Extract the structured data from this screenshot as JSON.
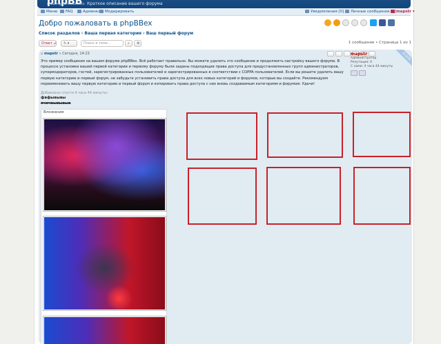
{
  "header": {
    "logo": "phpBB",
    "logo_sub": "creating communities",
    "site_desc": "Краткое описание вашего форума"
  },
  "nav": {
    "menu": "Меню",
    "faq": "FAQ",
    "admin": "Админка",
    "moderate": "Модерировать",
    "notifications": "Уведомления [0]",
    "messages": "Личные сообщения [0]",
    "user": "mapstr"
  },
  "topic": {
    "title": "Добро пожаловать в phpBBex"
  },
  "breadcrumbs": {
    "b1": "Список разделов",
    "b2": "Ваша первая категория",
    "b3": "Ваш первый форум",
    "sep": "›"
  },
  "toolbar": {
    "reply": "Ответ",
    "search_placeholder": "Поиск в теме...",
    "pagination": "1 сообщение • Страница 1 из 1"
  },
  "post": {
    "author": "mapstr",
    "date": "» Сегодня, 14:23",
    "text": "Это пример сообщения на вашем форуме phpBBex. Всё работает правильно. Вы можете удалить это сообщение и продолжить настройку вашего форума. В процессе установки вашей первой категории и первому форуму были заданы подходящие права доступа для предустановленных групп администраторов, супермодераторов, гостей, зарегистрированных пользователей и зарегистрированных в соответствии с COPPA пользователей. Если вы решите удалить вашу первую категорию и первый форум, не забудьте установить права доступа для всех новых категорий и форумов, которые вы создаёте. Рекомендуем переименовать вашу первую категорию и первый форум и копировать права доступа с них вновь создаваемым категориям и форумам. Удачи!",
    "added_notice": "Добавлено спустя 4 часа 44 минуты:",
    "sig1": "фвфывывы",
    "sig2": "ячячвывывыв",
    "attachments_label": "Вложения"
  },
  "profile": {
    "name": "mapstr",
    "role": "Администратор",
    "reputation": "Репутация: 0",
    "online": "С нами: 4 часа 44 минуты",
    "flag": "В СЕТИ"
  },
  "colors": {
    "header_blue": "#12457c",
    "link_blue": "#105289",
    "post_bg": "#e1ebf2",
    "annotation_red": "#c82027",
    "user_red": "#bc2a4d"
  }
}
